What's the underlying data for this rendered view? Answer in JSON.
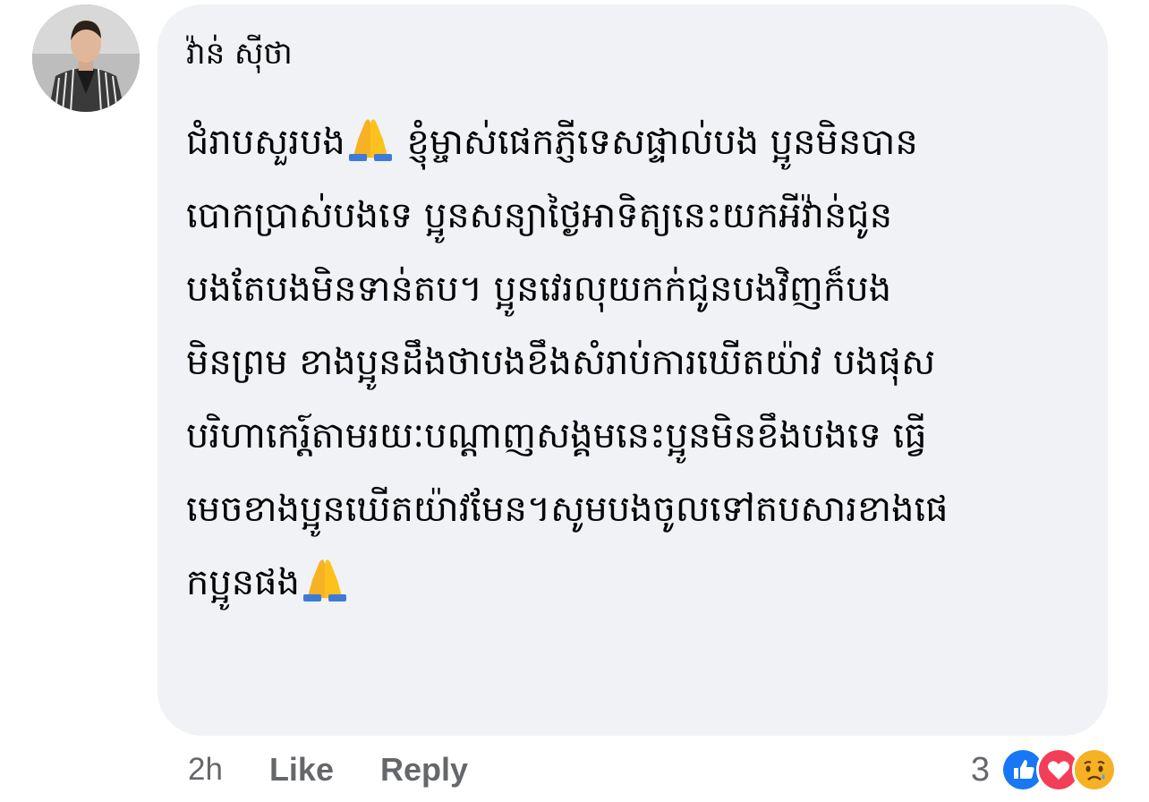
{
  "comment": {
    "author": "វ៉ាន់ សុីថា",
    "lines": [
      "ជំរាបសួរបង",
      "ខ្ញុំម្ចាស់ផេកភ្ញីទេសផ្ទាល់បង ប្អូនមិនបាន",
      "បោកប្រាស់បងទេ ប្អូនសន្យាថ្ងៃអាទិត្យនេះយកអីវ៉ាន់ជូន",
      "បងតែបងមិនទាន់តប។ ប្អូនវេរលុយកក់ជូនបងវិញក៏បង",
      "មិនព្រម ខាងប្អូនដឹងថាបងខឹងសំរាប់ការឃើតយ៉ាវ បងផុស",
      "បរិហាកេរ្ត៍តាមរយៈបណ្ដាញសង្គមនេះប្អូនមិនខឹងបងទេ ធ្វើ",
      "មេចខាងប្អូនឃើតយ៉ាវមែន។សូមបងចូលទៅតបសារខាងផេ",
      "កប្អូនផង"
    ],
    "emoji_1": "folded-hands-icon",
    "emoji_2": "folded-hands-icon"
  },
  "actions": {
    "time": "2h",
    "like_label": "Like",
    "reply_label": "Reply"
  },
  "reactions": {
    "count": "3",
    "icons": [
      "like-reaction-icon",
      "love-reaction-icon",
      "sad-reaction-icon"
    ],
    "colors": {
      "like": "#1877f2",
      "love": "#f33e58",
      "sad": "#f7b125"
    }
  },
  "colors": {
    "bubble": "#f0f2f5",
    "text": "#050505",
    "meta": "#65676b"
  }
}
